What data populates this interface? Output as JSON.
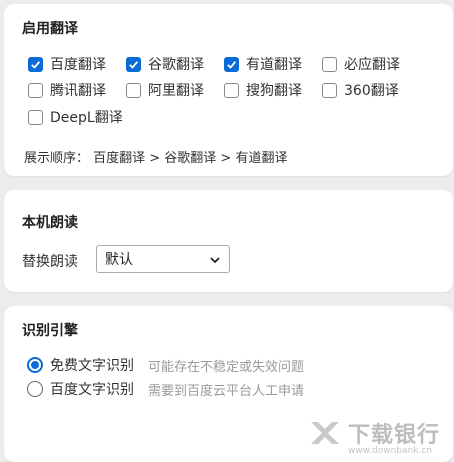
{
  "translate": {
    "title": "启用翻译",
    "options": [
      {
        "label": "百度翻译",
        "checked": true
      },
      {
        "label": "谷歌翻译",
        "checked": true
      },
      {
        "label": "有道翻译",
        "checked": true
      },
      {
        "label": "必应翻译",
        "checked": false
      },
      {
        "label": "腾讯翻译",
        "checked": false
      },
      {
        "label": "阿里翻译",
        "checked": false
      },
      {
        "label": "搜狗翻译",
        "checked": false
      },
      {
        "label": "360翻译",
        "checked": false
      },
      {
        "label": "DeepL翻译",
        "checked": false
      }
    ],
    "order_text": "展示顺序：  百度翻译  >  谷歌翻译  >  有道翻译"
  },
  "tts": {
    "title": "本机朗读",
    "replace_label": "替换朗读",
    "voice_value": "默认"
  },
  "ocr": {
    "title": "识别引擎",
    "options": [
      {
        "label": "免费文字识别",
        "hint": "可能存在不稳定或失效问题",
        "selected": true
      },
      {
        "label": "百度文字识别",
        "hint": "需要到百度云平台人工申请",
        "selected": false
      }
    ]
  },
  "watermark": {
    "text": "下载银行",
    "url": "www.downbank.cn"
  },
  "colors": {
    "accent": "#0a6ad6",
    "background": "#ececec"
  }
}
